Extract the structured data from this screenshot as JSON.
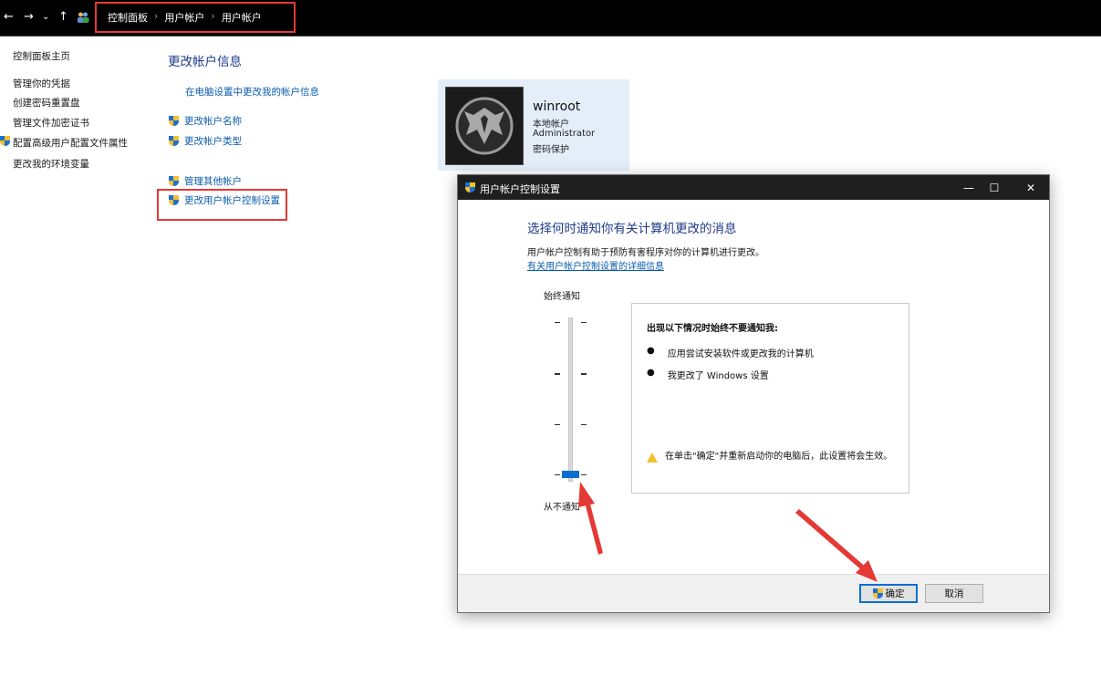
{
  "address_bar": {
    "back_glyph": "←",
    "forward_glyph": "→",
    "recent_glyph": "⌄",
    "up_glyph": "↑",
    "breadcrumbs": [
      "控制面板",
      "用户帐户",
      "用户帐户"
    ]
  },
  "left_pane": {
    "items": [
      "控制面板主页",
      "管理你的凭据",
      "创建密码重置盘",
      "管理文件加密证书",
      "配置高级用户配置文件属性",
      "更改我的环境变量"
    ]
  },
  "main": {
    "title": "更改帐户信息",
    "pc_settings_link": "在电脑设置中更改我的帐户信息",
    "links": [
      "更改帐户名称",
      "更改帐户类型"
    ],
    "links2": [
      "管理其他帐户",
      "更改用户帐户控制设置"
    ]
  },
  "account": {
    "name": "winroot",
    "type": "本地帐户",
    "group": "Administrator",
    "password": "密码保护"
  },
  "dialog": {
    "title": "用户帐户控制设置",
    "minimize": "—",
    "maximize": "☐",
    "close": "✕",
    "heading": "选择何时通知你有关计算机更改的消息",
    "description": "用户帐户控制有助于预防有害程序对你的计算机进行更改。",
    "more_link": "有关用户帐户控制设置的详细信息",
    "slider": {
      "top_label": "始终通知",
      "bottom_label": "从不通知",
      "levels": 4,
      "selected_level": 1
    },
    "info": {
      "title": "出现以下情况时始终不要通知我:",
      "bullets": [
        "应用尝试安装软件或更改我的计算机",
        "我更改了 Windows 设置"
      ],
      "warning": "在单击\"确定\"并重新启动你的电脑后，此设置将会生效。"
    },
    "ok_label": "确定",
    "cancel_label": "取消"
  },
  "colors": {
    "accent_blue": "#0a6ed1",
    "highlight_red": "#e53935",
    "title_blue": "#1e3a8a",
    "link_blue": "#0b5cad"
  }
}
